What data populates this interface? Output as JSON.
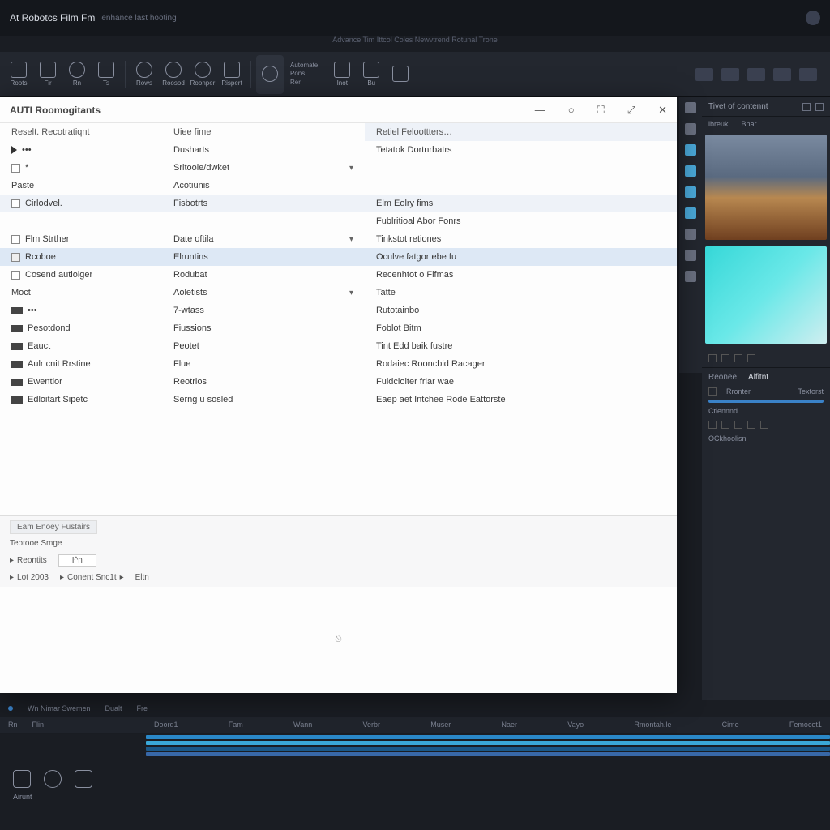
{
  "app": {
    "name": "At Robotcs Film Fm",
    "sub": "enhance last hooting",
    "subtitle": "Advance Tim Ittcol Coles Newvtrend Rotunal Trone"
  },
  "toolbar": {
    "items": [
      {
        "label": "Roots"
      },
      {
        "label": "Fir"
      },
      {
        "label": "Rn"
      },
      {
        "label": "Ts"
      },
      {
        "label": "Rows"
      },
      {
        "label": "Roosod"
      },
      {
        "label": "Roonper"
      },
      {
        "label": "Rispert"
      }
    ],
    "center": {
      "label": ""
    },
    "grp1": [
      "Automate",
      "Pons",
      "Rer"
    ],
    "grp2_items": [
      {
        "label": "Inot"
      },
      {
        "label": "Bu"
      },
      {
        "label": ""
      }
    ]
  },
  "modal": {
    "title": "AUTI Roomogitants",
    "headers": {
      "c1": "Reselt. Recotratiqnt",
      "c2": "Uiee fime",
      "c3": "Retiel Feloottters…"
    },
    "rows": [
      {
        "c1": "•••",
        "c2": "Dusharts",
        "c3": "Tetatok Dortnrbatrs",
        "icon": "tri",
        "band": false
      },
      {
        "c1": "*",
        "c2": "Sritoole/dwket",
        "c3": "",
        "icon": "ck",
        "chev": true
      },
      {
        "c1": "Paste",
        "c2": "Acotiunis",
        "c3": ""
      },
      {
        "c1": "Cirlodvel.",
        "c2": "Fisbotrts",
        "c3": "Elm Eolry fims",
        "icon": "ck",
        "band": true
      },
      {
        "c1": "",
        "c2": "",
        "c3": "Fublritioal Abor Fonrs"
      },
      {
        "c1": "Flm Strther",
        "c2": "Date oftila",
        "c3": "Tinkstot retiones",
        "icon": "ck",
        "chev": true
      },
      {
        "c1": "Rcoboe",
        "c2": "Elruntins",
        "c3": "Oculve fatgor ebe fu",
        "icon": "sq",
        "sel": true
      },
      {
        "c1": "Cosend autioiger",
        "c2": "Rodubat",
        "c3": "Recenhtot o Fifmas",
        "icon": "ck"
      },
      {
        "c1": "Moct",
        "c2": "Aoletists",
        "c3": "Tatte",
        "chev": true
      },
      {
        "c1": "•••",
        "c2": "7-wtass",
        "c3": "Rutotainbo",
        "icon": "bar"
      },
      {
        "c1": "Pesotdond",
        "c2": "Fiussions",
        "c3": "Foblot Bitm",
        "icon": "bar"
      },
      {
        "c1": "Eauct",
        "c2": "Peotet",
        "c3": "Tint Edd baik fustre",
        "icon": "bar"
      },
      {
        "c1": "Aulr cnit Rrstine",
        "c2": "Flue",
        "c3": "Rodaiec Rooncbid Racager",
        "icon": "bar"
      },
      {
        "c1": "Ewentior",
        "c2": "Reotrios",
        "c3": "Fuldclolter frlar wae",
        "icon": "bar"
      },
      {
        "c1": "Edloitart Sipetc",
        "c2": "Serng u sosled",
        "c3": "Eaep aet Intchee Rode Eattorste",
        "icon": "bar"
      }
    ],
    "lower": {
      "tab": "Eam Enoey Fustairs",
      "line": "Teotooe Smge",
      "crumbs": [
        {
          "l": "Reontits"
        },
        {
          "l": "I^n",
          "box": true
        },
        {
          "l": ""
        }
      ],
      "crumbs2": [
        {
          "l": "Lot 2003"
        },
        {
          "l": "Conent Snc1t"
        },
        {
          "l": "Eltn"
        }
      ]
    }
  },
  "rpanel": {
    "head": "Tivet of contennt",
    "tabs": [
      "lbreuk",
      "Bhar"
    ],
    "tabs2": [
      "Reonee",
      "Alfitnt"
    ],
    "props": [
      {
        "l": "Rronter"
      },
      {
        "l": "Textorst"
      }
    ],
    "sect": "Ctlennnd",
    "sect2": "OCkhoolisn"
  },
  "timeline": {
    "head": [
      "Wn Nimar Swemen",
      "Dualt",
      "Fre"
    ],
    "leftlabs": [
      "Rn",
      "Flin"
    ],
    "ticks": [
      "Doord1",
      "Fam",
      "Wann",
      "Verbr",
      "Muser",
      "Naer",
      "Vayo",
      "Rmontah.le",
      "Cime",
      "Femocot1"
    ]
  },
  "bottom": {
    "label": "Airunt"
  }
}
